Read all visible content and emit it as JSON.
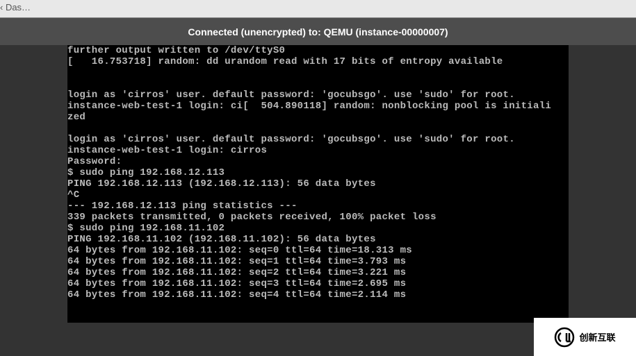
{
  "tab": {
    "label": "‹ Das…"
  },
  "status": {
    "text": "Connected (unencrypted) to: QEMU (instance-00000007)"
  },
  "console": {
    "lines": [
      "further output written to /dev/ttyS0",
      "[   16.753718] random: dd urandom read with 17 bits of entropy available",
      "",
      "",
      "login as 'cirros' user. default password: 'gocubsgo'. use 'sudo' for root.",
      "instance-web-test-1 login: ci[  504.890118] random: nonblocking pool is initiali",
      "zed",
      "",
      "login as 'cirros' user. default password: 'gocubsgo'. use 'sudo' for root.",
      "instance-web-test-1 login: cirros",
      "Password:",
      "$ sudo ping 192.168.12.113",
      "PING 192.168.12.113 (192.168.12.113): 56 data bytes",
      "^C",
      "--- 192.168.12.113 ping statistics ---",
      "339 packets transmitted, 0 packets received, 100% packet loss",
      "$ sudo ping 192.168.11.102",
      "PING 192.168.11.102 (192.168.11.102): 56 data bytes",
      "64 bytes from 192.168.11.102: seq=0 ttl=64 time=18.313 ms",
      "64 bytes from 192.168.11.102: seq=1 ttl=64 time=3.793 ms",
      "64 bytes from 192.168.11.102: seq=2 ttl=64 time=3.221 ms",
      "64 bytes from 192.168.11.102: seq=3 ttl=64 time=2.695 ms",
      "64 bytes from 192.168.11.102: seq=4 ttl=64 time=2.114 ms"
    ]
  },
  "watermark": {
    "text": "创新互联"
  }
}
